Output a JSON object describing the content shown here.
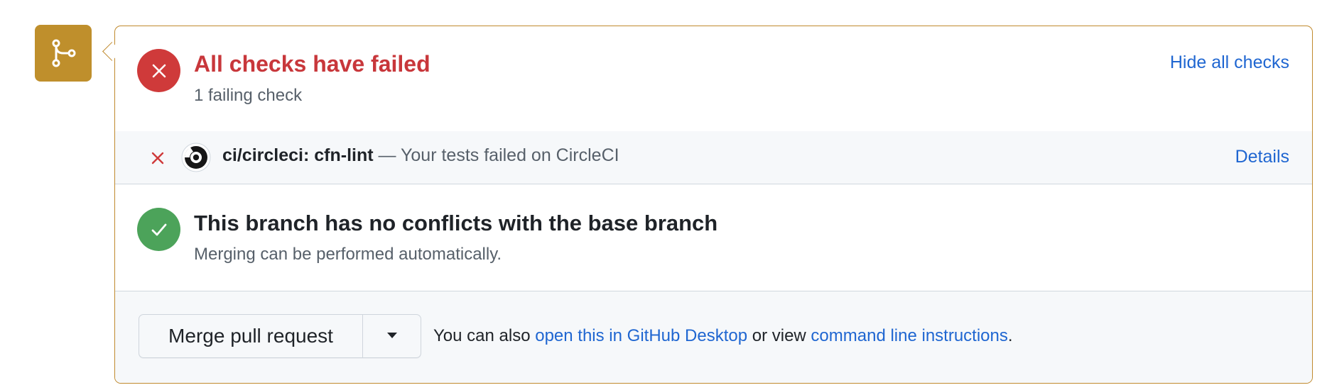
{
  "icons": {
    "merge": "git-merge-icon",
    "fail": "x-circle-icon",
    "success": "check-circle-icon",
    "check_fail": "x-icon",
    "provider": "circleci-logo",
    "caret": "triangle-down-icon"
  },
  "colors": {
    "merge_icon_bg": "#bf8f2c",
    "panel_border": "#c08a2e",
    "fail_red": "#cf3a3a",
    "success_green": "#4ca35a",
    "link_blue": "#1f66d1"
  },
  "checks_summary": {
    "title": "All checks have failed",
    "subtitle": "1 failing check",
    "toggle_link": "Hide all checks"
  },
  "check_item": {
    "name": "ci/circleci: cfn-lint",
    "separator": " — ",
    "description": "Your tests failed on CircleCI",
    "details_link": "Details"
  },
  "merge_status": {
    "title": "This branch has no conflicts with the base branch",
    "subtitle": "Merging can be performed automatically."
  },
  "merge_actions": {
    "merge_button": "Merge pull request",
    "also_prefix": "You can also ",
    "desktop_link": "open this in GitHub Desktop",
    "middle_text": " or view ",
    "cli_link": "command line instructions",
    "suffix": "."
  }
}
